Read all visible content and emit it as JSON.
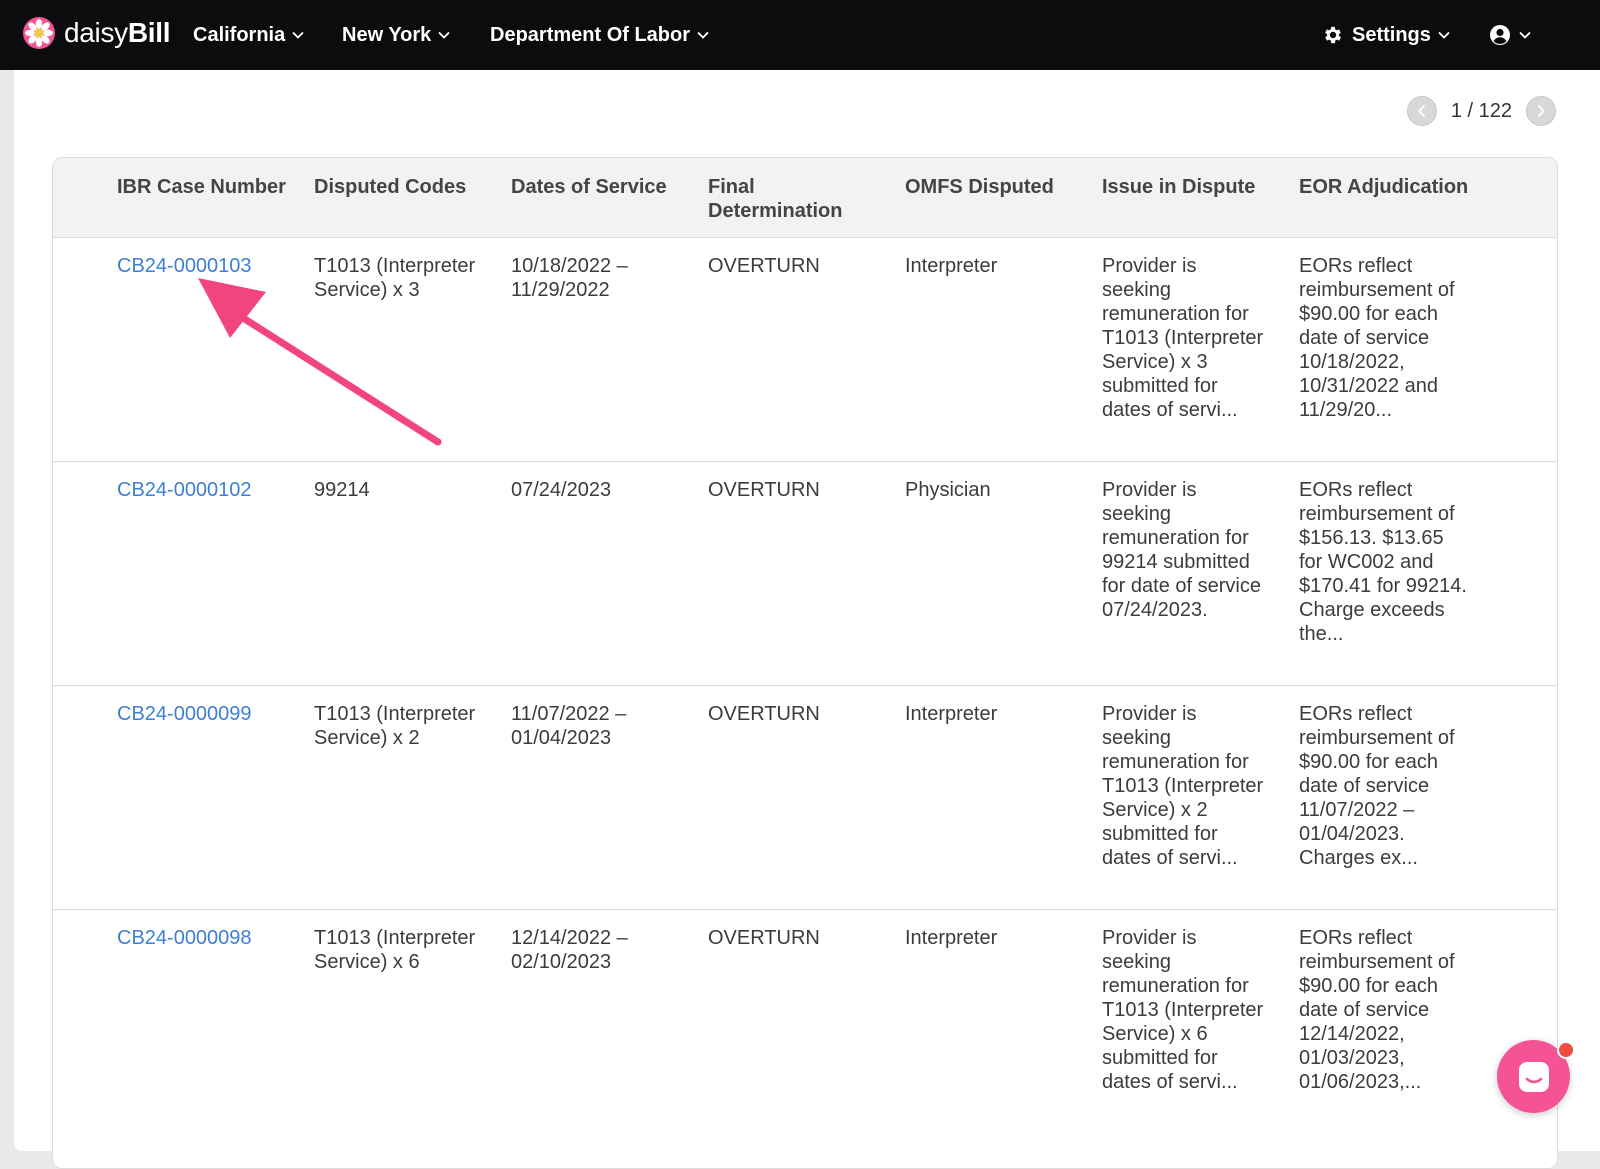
{
  "nav": {
    "brand": {
      "light": "daisy",
      "bold": "Bill"
    },
    "items": [
      {
        "label": "California"
      },
      {
        "label": "New York"
      },
      {
        "label": "Department Of Labor"
      }
    ],
    "settings_label": "Settings",
    "colors": {
      "topbar": "#0c0c0e",
      "accent": "#f45496",
      "link": "#3d7fd6"
    }
  },
  "pager": {
    "text": "1 / 122"
  },
  "table": {
    "headers": [
      "IBR Case Number",
      "Disputed Codes",
      "Dates of Service",
      "Final Determination",
      "OMFS Disputed",
      "Issue in Dispute",
      "EOR Adjudication"
    ],
    "rows": [
      {
        "case": "CB24-0000103",
        "codes": "T1013 (Interpreter Service) x 3",
        "dates": "10/18/2022 – 11/29/2022",
        "determination": "OVERTURN",
        "omfs": "Interpreter",
        "issue": "Provider is seeking remuneration for T1013 (Interpreter Service) x 3 submitted for dates of servi...",
        "eor": "EORs reflect reimbursement of $90.00 for each date of service 10/18/2022, 10/31/2022 and 11/29/20..."
      },
      {
        "case": "CB24-0000102",
        "codes": "99214",
        "dates": "07/24/2023",
        "determination": "OVERTURN",
        "omfs": "Physician",
        "issue": "Provider is seeking remuneration for 99214 submitted for date of service 07/24/2023.",
        "eor": "EORs reflect reimbursement of $156.13. $13.65 for WC002 and $170.41 for 99214. Charge exceeds the..."
      },
      {
        "case": "CB24-0000099",
        "codes": "T1013 (Interpreter Service) x 2",
        "dates": "11/07/2022 – 01/04/2023",
        "determination": "OVERTURN",
        "omfs": "Interpreter",
        "issue": "Provider is seeking remuneration for T1013 (Interpreter Service) x 2 submitted for dates of servi...",
        "eor": "EORs reflect reimbursement of $90.00 for each date of service 11/07/2022 – 01/04/2023. Charges ex..."
      },
      {
        "case": "CB24-0000098",
        "codes": "T1013 (Interpreter Service) x 6",
        "dates": "12/14/2022 – 02/10/2023",
        "determination": "OVERTURN",
        "omfs": "Interpreter",
        "issue": "Provider is seeking remuneration for T1013 (Interpreter Service) x 6 submitted for dates of servi...",
        "eor": "EORs reflect reimbursement of $90.00 for each date of service 12/14/2022, 01/03/2023, 01/06/2023,..."
      }
    ]
  }
}
